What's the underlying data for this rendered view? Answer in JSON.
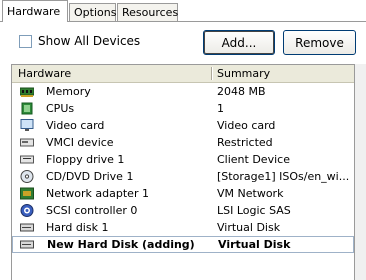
{
  "tabs": [
    {
      "label": "Hardware",
      "active": true
    },
    {
      "label": "Options",
      "active": false
    },
    {
      "label": "Resources",
      "active": false
    }
  ],
  "show_all_devices": {
    "label": "Show All Devices",
    "checked": false
  },
  "buttons": {
    "add": "Add...",
    "remove": "Remove"
  },
  "table": {
    "columns": [
      "Hardware",
      "Summary"
    ],
    "rows": [
      {
        "icon": "memory-icon",
        "hardware": "Memory",
        "summary": "2048 MB"
      },
      {
        "icon": "cpu-icon",
        "hardware": "CPUs",
        "summary": "1"
      },
      {
        "icon": "monitor-icon",
        "hardware": "Video card",
        "summary": "Video card"
      },
      {
        "icon": "device-icon",
        "hardware": "VMCI device",
        "summary": "Restricted"
      },
      {
        "icon": "floppy-icon",
        "hardware": "Floppy drive 1",
        "summary": "Client Device"
      },
      {
        "icon": "cd-drive-icon",
        "hardware": "CD/DVD Drive 1",
        "summary": "[Storage1] ISOs/en_wi..."
      },
      {
        "icon": "network-icon",
        "hardware": "Network adapter 1",
        "summary": "VM Network"
      },
      {
        "icon": "scsi-controller-icon",
        "hardware": "SCSI controller 0",
        "summary": "LSI Logic SAS"
      },
      {
        "icon": "hard-disk-icon",
        "hardware": "Hard disk 1",
        "summary": "Virtual Disk"
      },
      {
        "icon": "hard-disk-icon",
        "hardware": "New Hard Disk (adding)",
        "summary": "Virtual Disk",
        "selected": true
      }
    ]
  }
}
